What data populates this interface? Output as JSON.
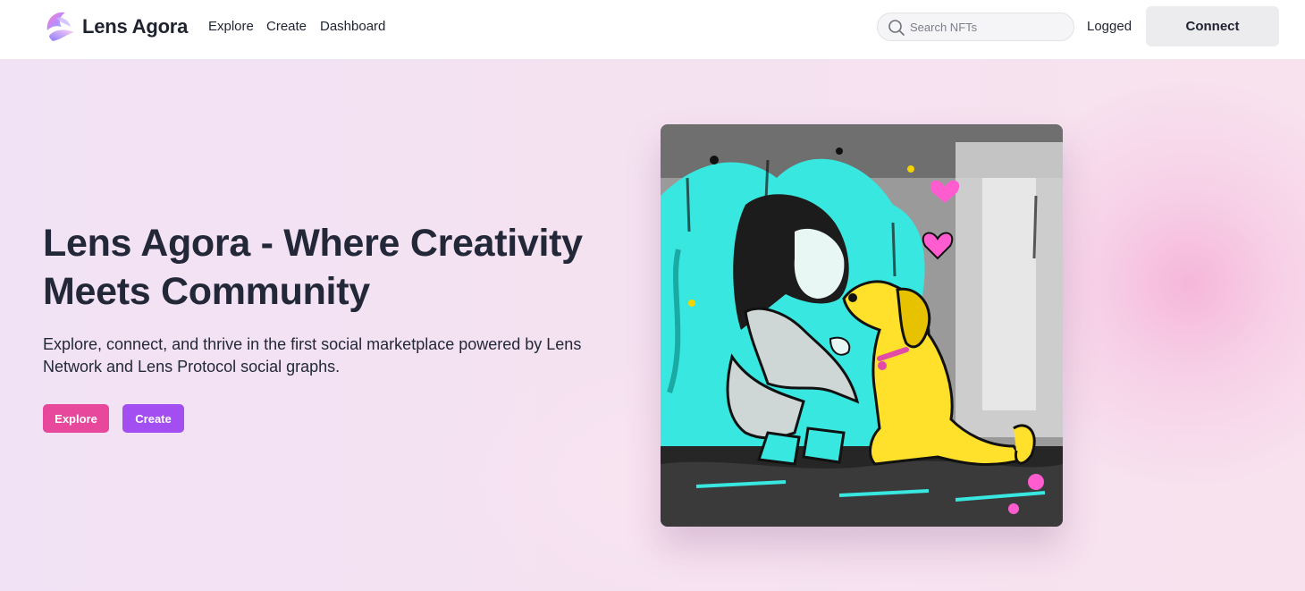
{
  "navbar": {
    "brand": "Lens Agora",
    "links": [
      {
        "label": "Explore"
      },
      {
        "label": "Create"
      },
      {
        "label": "Dashboard"
      }
    ],
    "search": {
      "placeholder": "Search NFTs",
      "value": ""
    },
    "status_text": "Logged",
    "connect_label": "Connect"
  },
  "hero": {
    "headline": "Lens Agora - Where Creativity Meets Community",
    "subtext": "Explore, connect, and thrive in the first social marketplace powered by Lens Network and Lens Protocol social graphs.",
    "buttons": {
      "explore_label": "Explore",
      "create_label": "Create"
    },
    "artwork": {
      "subject": "girl-and-dog-painting"
    }
  },
  "colors": {
    "explore_button": "#e8489b",
    "create_button": "#a34ef0",
    "connect_button": "#ececef",
    "text_dark": "#232838"
  }
}
